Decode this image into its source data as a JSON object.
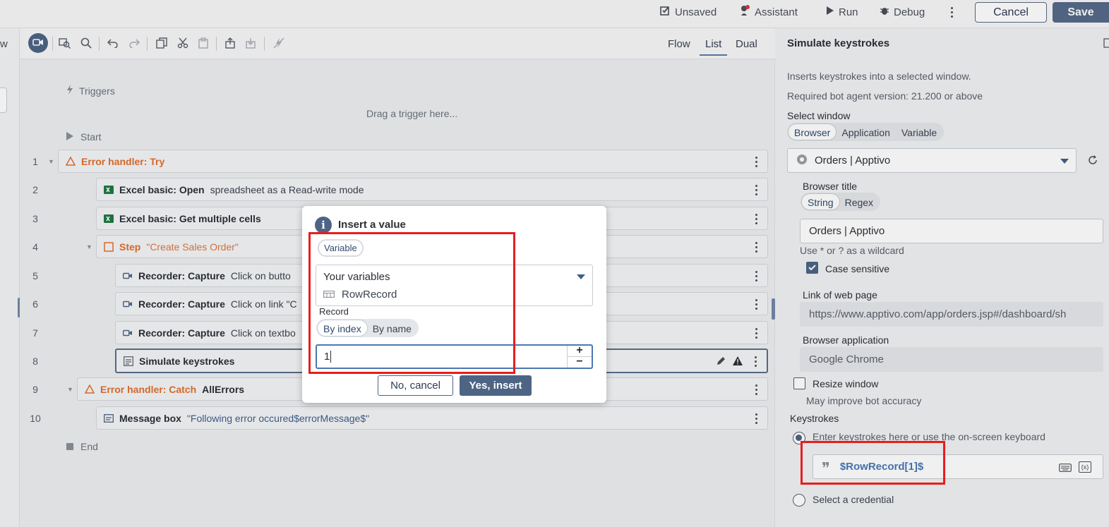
{
  "topbar": {
    "unsaved": "Unsaved",
    "assistant": "Assistant",
    "run": "Run",
    "debug": "Debug",
    "cancel": "Cancel",
    "save": "Save"
  },
  "left_edge": {
    "letter": "w"
  },
  "view_tabs": [
    "Flow",
    "List",
    "Dual"
  ],
  "active_view": "List",
  "flow": {
    "triggers": "Triggers",
    "drag_hint": "Drag a trigger here...",
    "start": "Start",
    "end": "End",
    "steps": [
      {
        "num": "1",
        "bold": "Error handler: Try",
        "desc": "",
        "icon": "warning-triangle-icon"
      },
      {
        "num": "2",
        "bold": "Excel basic: Open",
        "desc": "spreadsheet as a Read-write mode",
        "icon": "excel-icon"
      },
      {
        "num": "3",
        "bold": "Excel basic: Get multiple cells",
        "desc": "",
        "icon": "excel-icon"
      },
      {
        "num": "4",
        "bold": "Step",
        "desc": "\"Create Sales Order\"",
        "icon": "step-box-icon"
      },
      {
        "num": "5",
        "bold": "Recorder: Capture",
        "desc": "Click on butto",
        "icon": "camera-icon"
      },
      {
        "num": "6",
        "bold": "Recorder: Capture",
        "desc": "Click on link \"C",
        "icon": "camera-icon"
      },
      {
        "num": "7",
        "bold": "Recorder: Capture",
        "desc": "Click on textbo",
        "icon": "camera-icon"
      },
      {
        "num": "8",
        "bold": "Simulate keystrokes",
        "desc": "",
        "icon": "keyboard-window-icon"
      },
      {
        "num": "9",
        "bold": "Error handler: Catch",
        "desc": "AllErrors",
        "icon": "warning-triangle-icon"
      },
      {
        "num": "10",
        "bold": "Message box",
        "desc": "\"Following error occured$errorMessage$\"",
        "icon": "message-box-icon"
      }
    ]
  },
  "panel": {
    "title": "Simulate keystrokes",
    "description": "Inserts keystrokes into a selected window.",
    "version": "Required bot agent version: 21.200 or above",
    "select_window_label": "Select window",
    "window_types": [
      "Browser",
      "Application",
      "Variable"
    ],
    "window_type_selected": "Browser",
    "window_value": "Orders | Apptivo",
    "browser_title_label": "Browser title",
    "title_match": [
      "String",
      "Regex"
    ],
    "title_match_selected": "String",
    "browser_title_value": "Orders | Apptivo",
    "wildcard_hint": "Use * or ? as a wildcard",
    "case_sensitive": "Case sensitive",
    "link_label": "Link of web page",
    "link_value": "https://www.apptivo.com/app/orders.jsp#/dashboard/sh",
    "browser_app_label": "Browser application",
    "browser_app_value": "Google Chrome",
    "resize_window": "Resize window",
    "resize_hint": "May improve bot accuracy",
    "keystrokes_label": "Keystrokes",
    "keystrokes_option": "Enter keystrokes here or use the on-screen keyboard",
    "keystrokes_value": "$RowRecord[1]$",
    "credential_option": "Select a credential"
  },
  "modal": {
    "title": "Insert a value",
    "chip": "Variable",
    "your_variables": "Your variables",
    "variable_item": "RowRecord",
    "record_label": "Record",
    "record_modes": [
      "By index",
      "By name"
    ],
    "record_mode_selected": "By index",
    "index_value": "1",
    "stepper_plus": "+",
    "stepper_minus": "−",
    "no_cancel": "No, cancel",
    "yes_insert": "Yes, insert"
  },
  "colors": {
    "accent": "#4d6485",
    "warning": "#e0702f",
    "highlight": "#e81d1d",
    "focus": "#4b77b3"
  }
}
